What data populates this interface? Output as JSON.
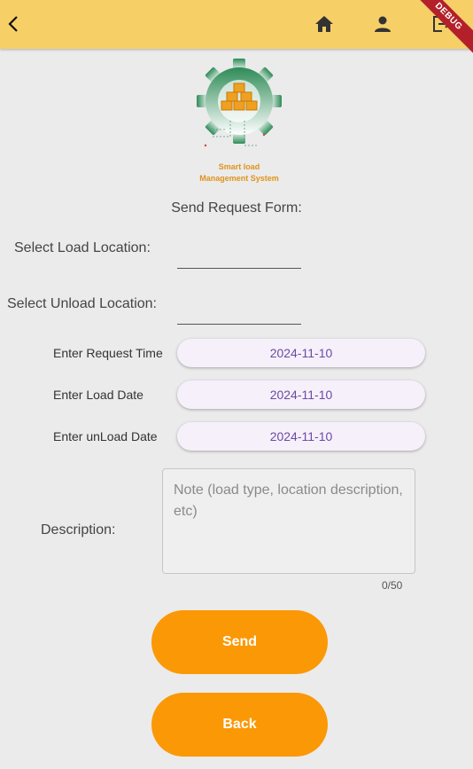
{
  "appbar": {
    "back_icon": "chevron-left-icon",
    "home_icon": "home-icon",
    "profile_icon": "person-icon",
    "logout_icon": "logout-icon",
    "debug_banner": "DEBUG",
    "color": "#f6cf67"
  },
  "logo": {
    "line1": "Smart load",
    "line2": "Management System"
  },
  "form": {
    "title": "Send Request Form:",
    "load_location_label": "Select Load Location:",
    "unload_location_label": "Select Unload Location:",
    "request_time_label": "Enter Request Time",
    "request_time_value": "2024-11-10",
    "load_date_label": "Enter Load Date",
    "load_date_value": "2024-11-10",
    "unload_date_label": "Enter unLoad Date",
    "unload_date_value": "2024-11-10",
    "description_label": "Description:",
    "description_placeholder": "Note (load type, location description, etc)",
    "description_counter": "0/50"
  },
  "buttons": {
    "send": "Send",
    "back": "Back",
    "color": "#fb9806"
  }
}
